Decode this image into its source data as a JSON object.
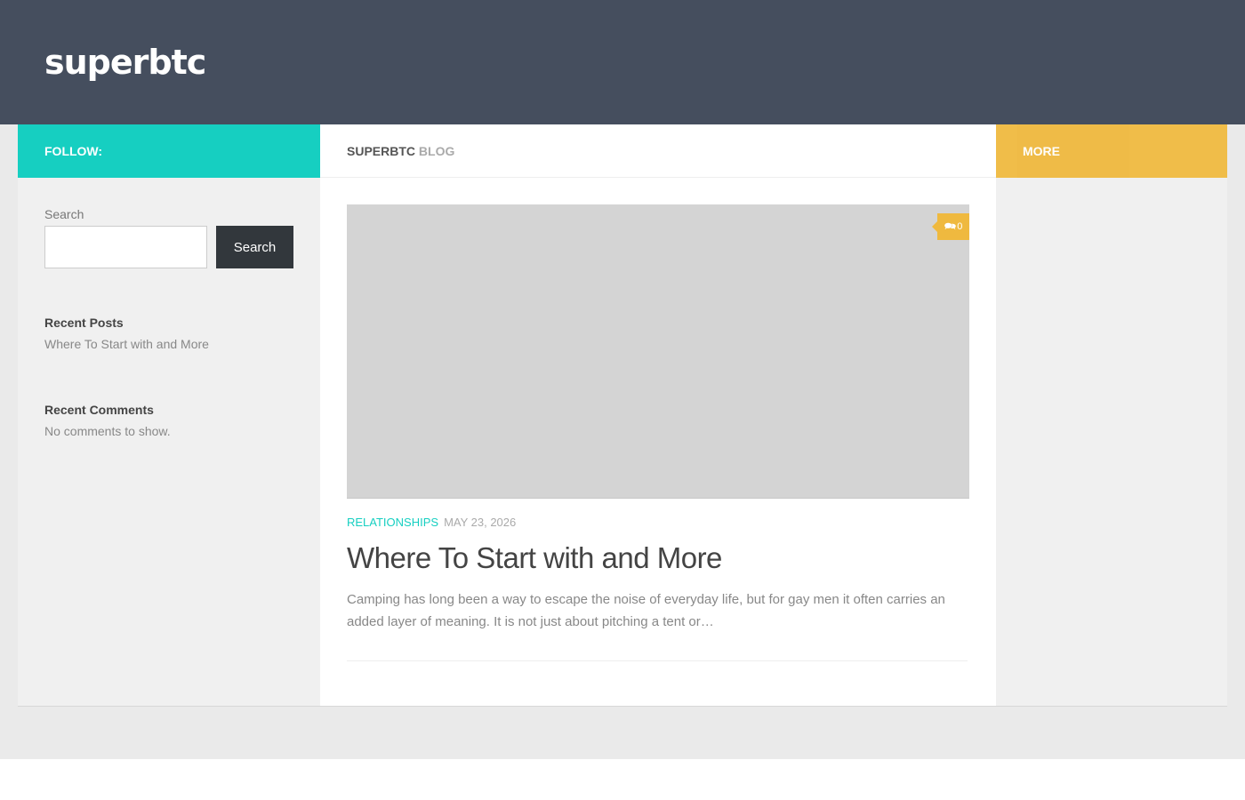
{
  "site": {
    "title": "superbtc"
  },
  "colors": {
    "header_bg": "#454e5e",
    "accent_teal": "#16cfc1",
    "accent_yellow": "#efb93f",
    "sidebar_bg": "#f0f0f0",
    "button_dark": "#32373c"
  },
  "bars": {
    "follow_label": "FOLLOW:",
    "more_label": "MORE",
    "blog_heading_strong": "SUPERBTC",
    "blog_heading_light": "BLOG"
  },
  "search": {
    "label": "Search",
    "button_label": "Search",
    "value": ""
  },
  "widgets": {
    "recent_posts": {
      "title": "Recent Posts",
      "items": [
        "Where To Start with and More"
      ]
    },
    "recent_comments": {
      "title": "Recent Comments",
      "empty_text": "No comments to show."
    }
  },
  "post": {
    "category": "RELATIONSHIPS",
    "date": "MAY 23, 2026",
    "title": "Where To Start with and More",
    "excerpt": "Camping has long been a way to escape the noise of everyday life, but for gay men it often carries an added layer of meaning. It is not just about pitching a tent or…",
    "comment_count": "0",
    "comment_icon": "comments-icon"
  }
}
